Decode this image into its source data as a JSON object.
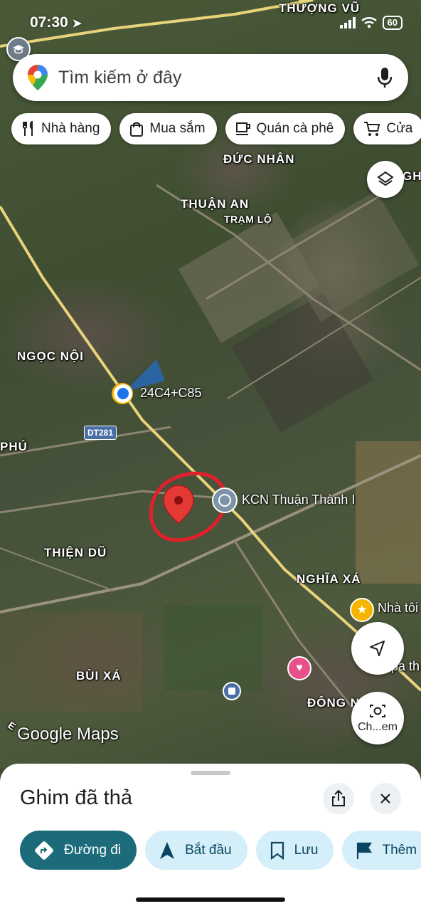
{
  "status_bar": {
    "time": "07:30",
    "battery": "60"
  },
  "search": {
    "placeholder": "Tìm kiếm ở đây"
  },
  "chips": [
    {
      "label": "Nhà hàng",
      "icon": "fork-knife-icon"
    },
    {
      "label": "Mua sắm",
      "icon": "shopping-bag-icon"
    },
    {
      "label": "Quán cà phê",
      "icon": "coffee-cup-icon"
    },
    {
      "label": "Cửa",
      "icon": "cart-icon"
    }
  ],
  "map": {
    "places": {
      "thuong_vu": "THƯỢNG VŨ",
      "duc_nhan": "ĐỨC NHÂN",
      "thuan_an": "THUẬN AN",
      "tram_lo": "TRẠM LỘ",
      "ngoc_noi": "NGỌC NỘI",
      "phu": "PHÚ",
      "thien_du": "THIỆN DŨ",
      "nghia_xa": "NGHĨA XÁ",
      "bui_xa": "BÙI XÁ",
      "dong": "ĐÔNG N",
      "edge_gh": "GH"
    },
    "road_shield": "DT281",
    "current_location_code": "24C4+C85",
    "poi_industrial": "KCN Thuận Thành I",
    "poi_home": "Nhà tôi",
    "poi_partial": "pa th",
    "camera_label": "Ch...em",
    "attribution": "Google Maps",
    "road_edge_label": "E",
    "colors": {
      "road": "#e8d37a",
      "pin": "#e53935",
      "circle_annotation": "#e0202b",
      "location_dot": "#1a73e8"
    }
  },
  "sheet": {
    "title": "Ghim đã thả",
    "actions": [
      {
        "label": "Đường đi",
        "icon": "directions-icon",
        "primary": true
      },
      {
        "label": "Bắt đầu",
        "icon": "navigation-arrow-icon"
      },
      {
        "label": "Lưu",
        "icon": "bookmark-icon"
      },
      {
        "label": "Thêm",
        "icon": "flag-icon"
      }
    ]
  }
}
